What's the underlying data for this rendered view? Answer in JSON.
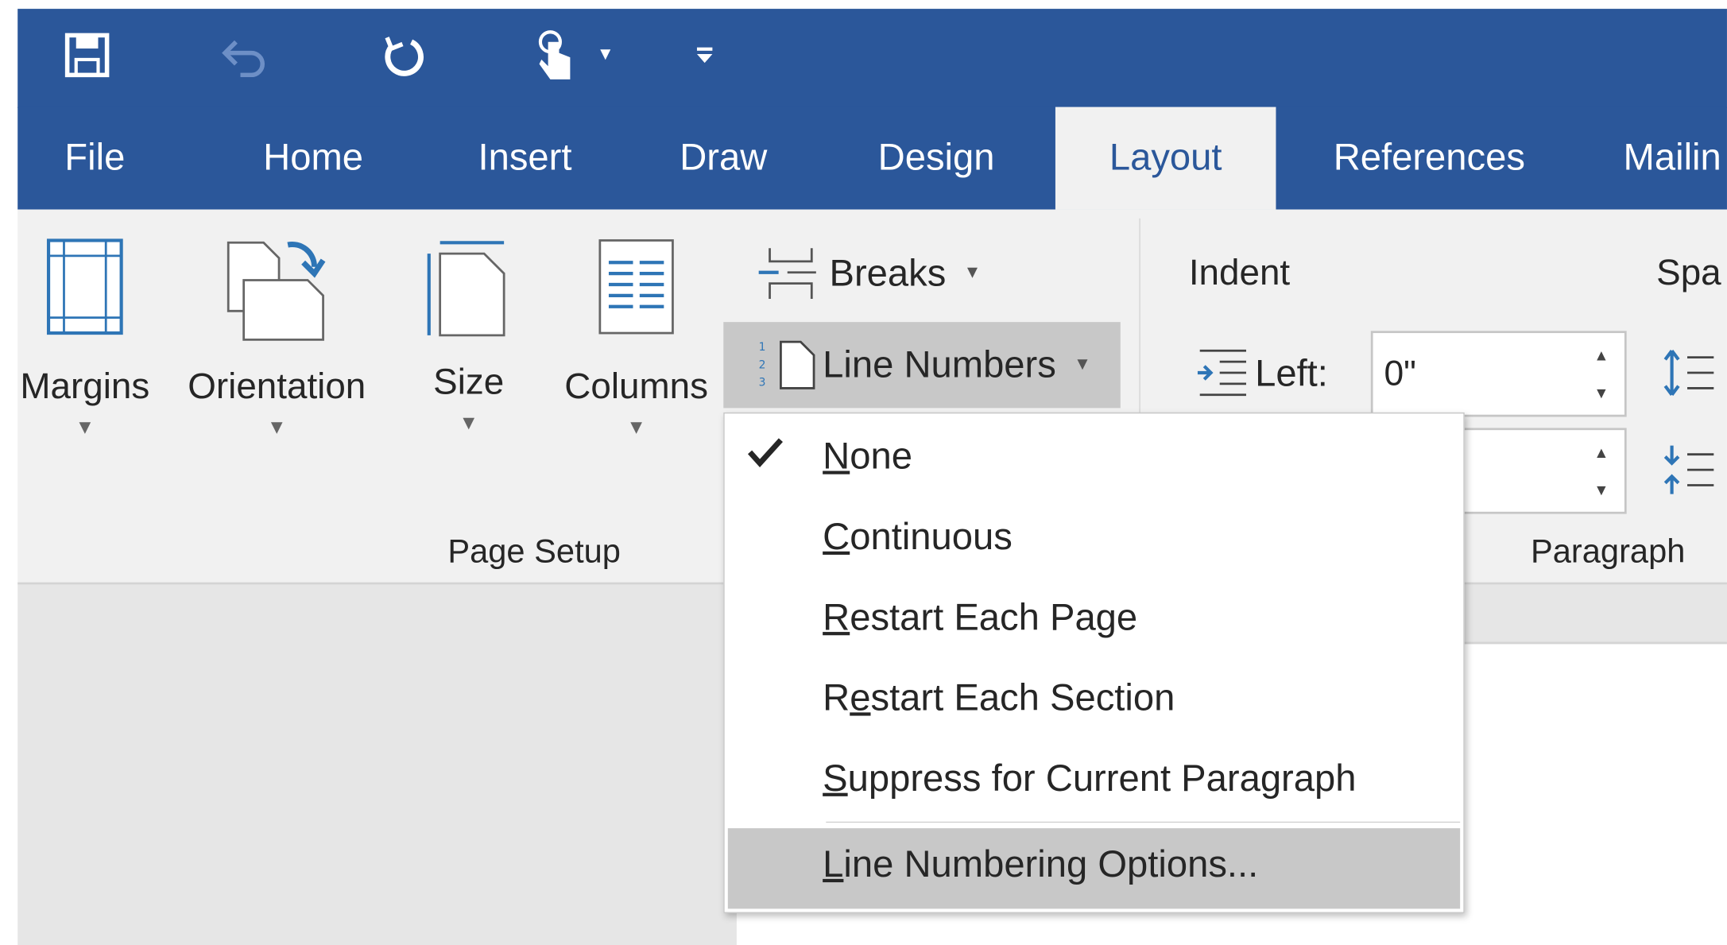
{
  "quick_access": {
    "icons": [
      "save-icon",
      "undo-icon",
      "redo-icon",
      "touch-mode-icon",
      "dropdown-arrow-icon",
      "customize-qat-icon"
    ]
  },
  "tabs": [
    {
      "label": "File"
    },
    {
      "label": "Home"
    },
    {
      "label": "Insert"
    },
    {
      "label": "Draw"
    },
    {
      "label": "Design"
    },
    {
      "label": "Layout",
      "active": true
    },
    {
      "label": "References"
    },
    {
      "label": "Mailin"
    }
  ],
  "page_setup": {
    "margins": "Margins",
    "orientation": "Orientation",
    "size": "Size",
    "columns": "Columns",
    "breaks": "Breaks",
    "line_numbers": "Line Numbers",
    "group_label": "Page Setup"
  },
  "paragraph": {
    "indent_title": "Indent",
    "left_label": "Left:",
    "left_value": "0\"",
    "right_value": "",
    "spacing_title": "Spa",
    "group_label": "Paragraph"
  },
  "line_numbers_menu": {
    "items": [
      {
        "pre": "",
        "key": "N",
        "post": "one",
        "checked": true
      },
      {
        "pre": "",
        "key": "C",
        "post": "ontinuous"
      },
      {
        "pre": "",
        "key": "R",
        "post": "estart Each Page"
      },
      {
        "pre": "R",
        "key": "e",
        "post": "start Each Section"
      },
      {
        "pre": "",
        "key": "S",
        "post": "uppress for Current Paragraph"
      },
      {
        "pre": "",
        "key": "L",
        "post": "ine Numbering Options..."
      }
    ]
  },
  "colors": {
    "title_bar": "#2b579a",
    "ribbon": "#f1f1f1",
    "hover": "#c8c8c8",
    "icon_blue": "#2e75b6"
  }
}
